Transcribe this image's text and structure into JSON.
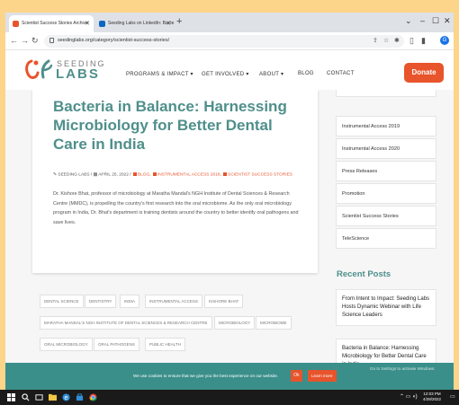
{
  "browser": {
    "tabs": [
      {
        "label": "Scientist Success Stories Archive",
        "favicon_color": "#e8542b"
      },
      {
        "label": "Seeding Labs on LinkedIn: Bacte",
        "favicon_color": "#0a66c2"
      }
    ],
    "new_tab_glyph": "+",
    "window_controls": [
      "⌄",
      "–",
      "☐",
      "✕"
    ],
    "url": "seedinglabs.org/category/scientist-success-stories/",
    "profile_initial": "G"
  },
  "site": {
    "logo_top": "SEEDING",
    "logo_bottom": "LABS",
    "nav": [
      "PROGRAMS & IMPACT ▾",
      "GET INVOLVED ▾",
      "ABOUT ▾",
      "BLOG",
      "CONTACT"
    ],
    "donate_label": "Donate",
    "brand_color": "#4f8f8b",
    "accent_color": "#e8542b"
  },
  "post": {
    "title": "Bacteria in Balance: Harnessing Microbiology for Better Dental Care in India",
    "author": "SEEDING LABS",
    "date": "APRIL 25, 2022",
    "categories": [
      "BLOG",
      "INSTRUMENTAL ACCESS 2018",
      "SCIENTIST SUCCESS STORIES"
    ],
    "excerpt": "Dr. Kishore Bhat, professor of microbiology at Maratha Mandal's NGH Institute of Dental Sciences & Research Centre (MMDC), is propelling the country's first research into the oral microbiome. As the only oral microbiology program in India, Dr. Bhat's department is training dentists around the country to better identify oral pathogens and save lives.",
    "tags": [
      "DENTAL SCIENCE",
      "DENTISTRY",
      "INDIA",
      "INSTRUMENTAL ACCESS",
      "KISHORE BHAT",
      "MARATHA MANDAL'S NGH INSTITUTE OF DENTAL SCIENCES & RESEARCH CENTRE",
      "MICROBIOLOGY",
      "MICROBIOME",
      "ORAL MICROBIOLOGY",
      "ORAL PATHOGENS",
      "PUBLIC HEALTH"
    ]
  },
  "sidebar": {
    "links": [
      "Instrumental Access 2019",
      "Instrumental Access 2020",
      "Press Releases",
      "Promotion",
      "Scientist Success Stories",
      "TeleScience"
    ],
    "recent_heading": "Recent Posts",
    "recent": [
      "From Intent to Impact: Seeding Labs Hosts Dynamic Webinar with Life Science Leaders",
      "Bacteria in Balance: Harnessing Microbiology for Better Dental Care in India"
    ]
  },
  "cookie": {
    "text": "We use cookies to ensure that we give you the best experience on our website.",
    "ok_label": "Ok",
    "learn_label": "Learn more",
    "watermark": "Go to Settings to activate Windows."
  },
  "taskbar": {
    "time": "12:03 PM",
    "date": "4/28/2022"
  }
}
